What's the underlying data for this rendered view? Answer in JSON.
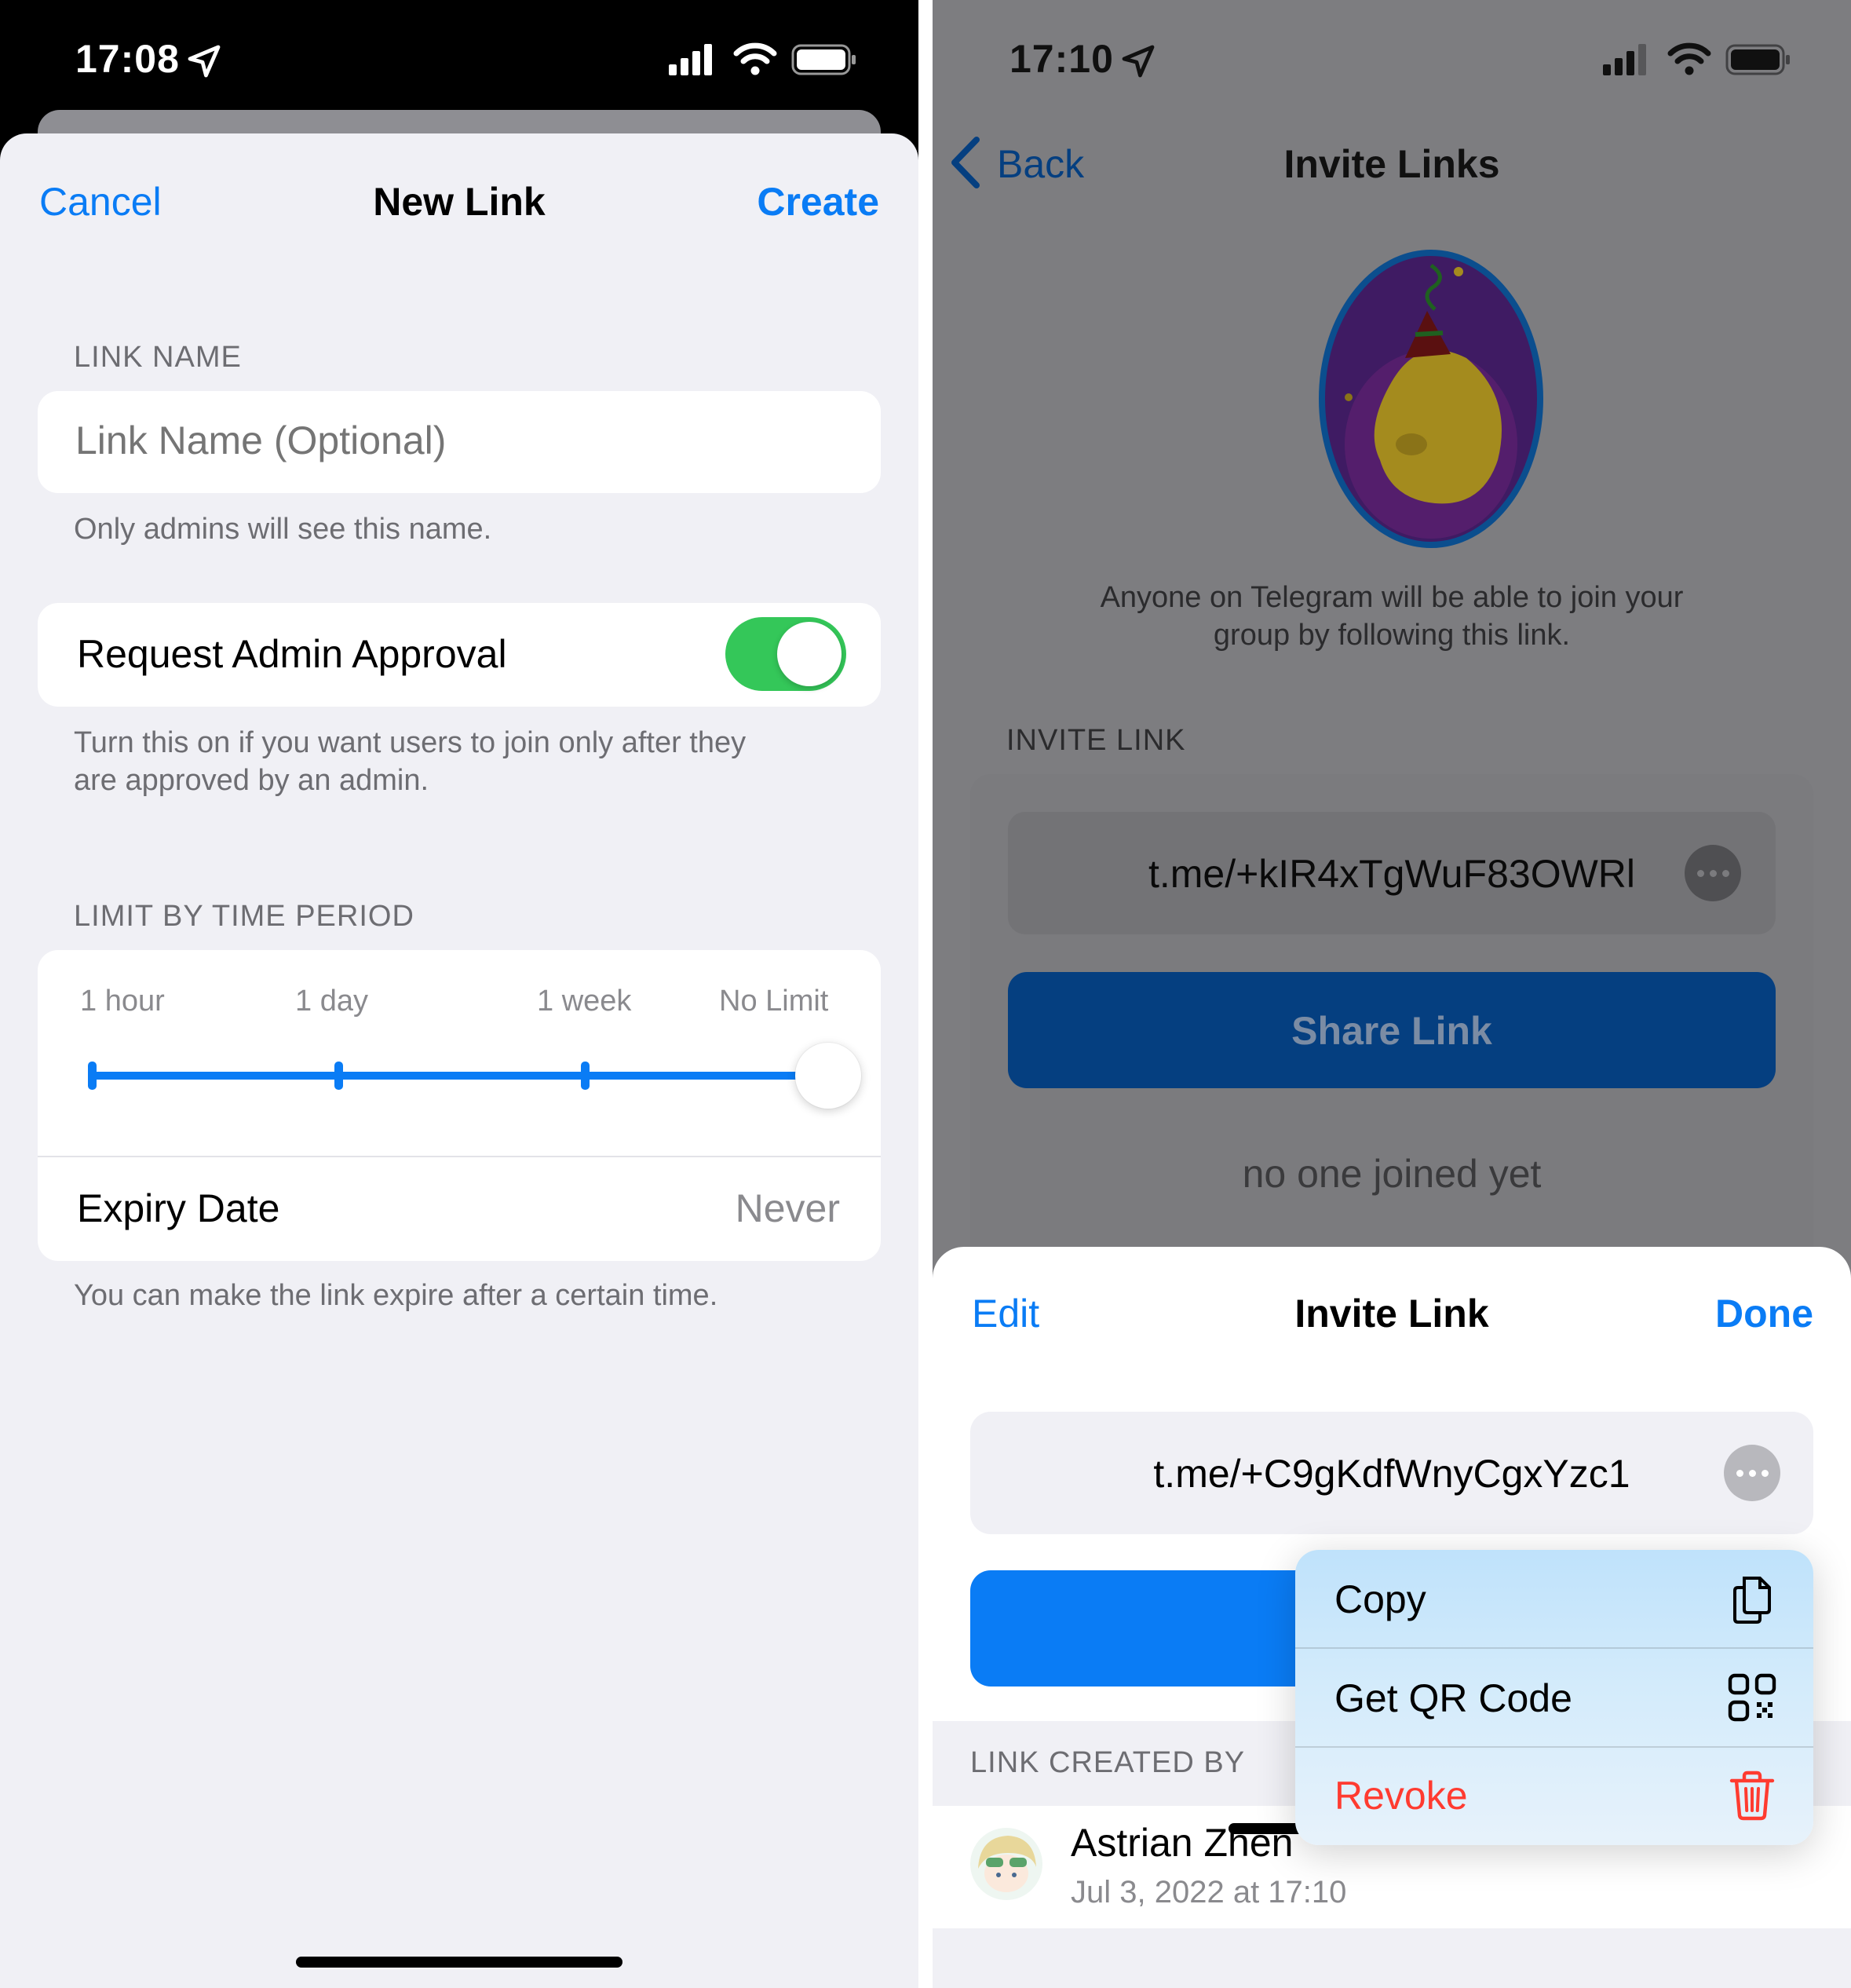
{
  "left": {
    "status": {
      "time": "17:08"
    },
    "nav": {
      "cancel": "Cancel",
      "title": "New Link",
      "create": "Create"
    },
    "link_name": {
      "section_label": "LINK NAME",
      "placeholder": "Link Name (Optional)",
      "footer": "Only admins will see this name."
    },
    "approval": {
      "label": "Request Admin Approval",
      "toggle_on": true,
      "footer_line1": "Turn this on if you want users to join only after they",
      "footer_line2": "are approved by an admin."
    },
    "time_limit": {
      "section_label": "LIMIT BY TIME PERIOD",
      "ticks": [
        "1 hour",
        "1 day",
        "1 week",
        "No Limit"
      ],
      "selected": "No Limit",
      "expiry_label": "Expiry Date",
      "expiry_value": "Never",
      "footer": "You can make the link expire after a certain time."
    }
  },
  "right": {
    "status": {
      "time": "17:10"
    },
    "nav": {
      "back": "Back",
      "title": "Invite Links"
    },
    "description_line1": "Anyone on Telegram will be able to join your",
    "description_line2": "group by following this link.",
    "invite_section_label": "INVITE LINK",
    "primary_link": "t.me/+kIR4xTgWuF83OWRl",
    "share_button": "Share Link",
    "joined_text": "no one joined yet",
    "sheet": {
      "edit": "Edit",
      "title": "Invite Link",
      "done": "Done",
      "link": "t.me/+C9gKdfWnyCgxYzc1",
      "created_by_label": "LINK CREATED BY",
      "creator_name": "Astrian Zhen",
      "created_at": "Jul 3, 2022 at 17:10"
    },
    "menu": {
      "copy": "Copy",
      "qr": "Get QR Code",
      "revoke": "Revoke"
    }
  },
  "colors": {
    "accent_blue": "#0a7cf5",
    "toggle_green": "#34c759",
    "destructive_red": "#ff3b30",
    "group_bg": "#f0f0f5"
  }
}
